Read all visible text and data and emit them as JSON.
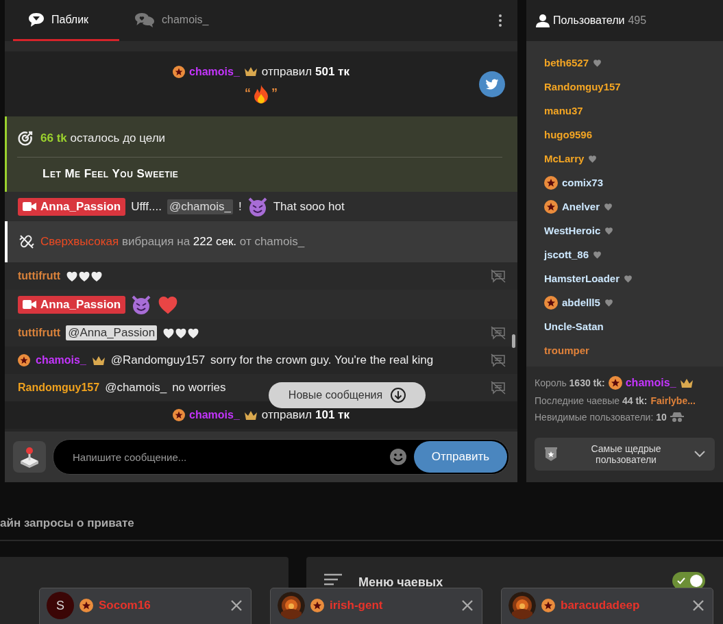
{
  "chat": {
    "tabs": [
      {
        "label": "Паблик",
        "selected": true
      },
      {
        "label": "chamois_",
        "selected": false
      }
    ],
    "messages": [
      {
        "kind": "tip",
        "user": {
          "name": "chamois_",
          "color": "#c535ff",
          "badge": true,
          "crown": true
        },
        "action": "отправил",
        "amount": "501 тк",
        "quote_open": "“",
        "quote_close": "”",
        "twitter": true
      },
      {
        "kind": "goal",
        "amount": "66 tk",
        "text": "осталось до цели",
        "title": "Let Me Feel You Sweetie"
      },
      {
        "kind": "model",
        "user": {
          "name": "Anna_Passion"
        },
        "parts": [
          {
            "kind": "text",
            "text": "Ufff...."
          },
          {
            "kind": "mention-dark",
            "text": "@chamois_"
          },
          {
            "kind": "text",
            "text": "!"
          },
          {
            "kind": "devil"
          },
          {
            "kind": "text",
            "text": "That sooo hot"
          }
        ]
      },
      {
        "kind": "vibration",
        "intensity": "Сверхвысокая",
        "middle": "вибрация на",
        "duration": "222 сек.",
        "from": "от chamois_"
      },
      {
        "kind": "chat",
        "user": {
          "name": "tuttifrutt",
          "color": "#d9823b",
          "badge": false,
          "crown": false
        },
        "parts": [
          {
            "kind": "white-hearts"
          }
        ]
      },
      {
        "kind": "model",
        "user": {
          "name": "Anna_Passion"
        },
        "parts": [
          {
            "kind": "devil"
          },
          {
            "kind": "heart"
          }
        ]
      },
      {
        "kind": "chat",
        "user": {
          "name": "tuttifrutt",
          "color": "#d9823b",
          "badge": false,
          "crown": false
        },
        "parts": [
          {
            "kind": "mention-light",
            "text": "@Anna_Passion"
          },
          {
            "kind": "white-hearts"
          }
        ]
      },
      {
        "kind": "chat",
        "user": {
          "name": "chamois_",
          "color": "#c535ff",
          "badge": true,
          "crown": true
        },
        "parts": [
          {
            "kind": "mention",
            "text": "@Randomguy157"
          },
          {
            "kind": "text",
            "text": "sorry for the crown guy. You're the real king"
          }
        ]
      },
      {
        "kind": "chat",
        "user": {
          "name": "Randomguy157",
          "color": "#f0a21e",
          "badge": false,
          "crown": false
        },
        "parts": [
          {
            "kind": "mention",
            "text": "@chamois_"
          },
          {
            "kind": "text",
            "text": "no worries"
          }
        ]
      },
      {
        "kind": "tip",
        "user": {
          "name": "chamois_",
          "color": "#c535ff",
          "badge": true,
          "crown": true
        },
        "action": "отправил",
        "amount": "101 тк",
        "twitter": false
      }
    ],
    "new_messages": "Новые сообщения",
    "input": {
      "placeholder": "Напишите сообщение..."
    },
    "send": "Отправить"
  },
  "users": {
    "title": "Пользователи",
    "count": "495",
    "items": [
      {
        "name": "beth6527",
        "color": "#f5a623",
        "badge": false,
        "heart": true
      },
      {
        "name": "Randomguy157",
        "color": "#f5a623",
        "badge": false,
        "heart": false
      },
      {
        "name": "manu37",
        "color": "#f5a623",
        "badge": false,
        "heart": false
      },
      {
        "name": "hugo9596",
        "color": "#f5a623",
        "badge": false,
        "heart": false
      },
      {
        "name": "McLarry",
        "color": "#f5a623",
        "badge": false,
        "heart": true
      },
      {
        "name": "comix73",
        "color": "#cde8ff",
        "badge": true,
        "heart": false
      },
      {
        "name": "Anelver",
        "color": "#cde8ff",
        "badge": true,
        "heart": true
      },
      {
        "name": "WestHeroic",
        "color": "#cde8ff",
        "badge": false,
        "heart": true
      },
      {
        "name": "jscott_86",
        "color": "#cde8ff",
        "badge": false,
        "heart": true
      },
      {
        "name": "HamsterLoader",
        "color": "#cde8ff",
        "badge": false,
        "heart": true
      },
      {
        "name": "abdelll5",
        "color": "#cde8ff",
        "badge": true,
        "heart": true
      },
      {
        "name": "Uncle-Satan",
        "color": "#cde8ff",
        "badge": false,
        "heart": false
      },
      {
        "name": "troumper",
        "color": "#e0823a",
        "badge": false,
        "heart": false
      }
    ],
    "king": {
      "label": "Король",
      "amount": "1630 tk:",
      "user": "chamois_"
    },
    "last_tip": {
      "label": "Последние чаевые",
      "amount": "44 tk:",
      "user": "Fairlybe..."
    },
    "invisible": {
      "label": "Невидимые пользователи:",
      "count": "10"
    },
    "top_button": "Самые щедрые пользователи"
  },
  "private_requests": "айн запросы о привате",
  "tip_menu": {
    "title": "Меню чаевых",
    "on": true
  },
  "private_chats": [
    {
      "name": "Socom16",
      "kind": "letter",
      "letter": "S"
    },
    {
      "name": "irish-gent",
      "kind": "picture"
    },
    {
      "name": "baracudadeep",
      "kind": "picture"
    }
  ]
}
